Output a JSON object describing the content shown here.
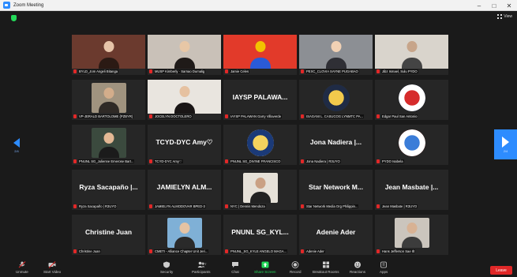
{
  "window": {
    "title": "Zoom Meeting",
    "controls": [
      "–",
      "□",
      "✕"
    ]
  },
  "view_label": "View",
  "pagination": {
    "left": "2/4",
    "right": "2/4"
  },
  "colors": {
    "accent": "#2d8cff",
    "leave": "#e02828",
    "tile_bg": "#262626",
    "muted_mic": "#e02828",
    "security": "#23d959"
  },
  "tiles": [
    {
      "name": "BYLD_Jom Angeli Bitanga",
      "big": "",
      "kind": "photo"
    },
    {
      "name": "MUSP Kimberly · Sarnao Dumalig",
      "big": "",
      "kind": "photo"
    },
    {
      "name": "Jamie Celes",
      "big": "",
      "kind": "photo"
    },
    {
      "name": "PEXC_CLOVIA SAYNE PUGABAO",
      "big": "",
      "kind": "photo"
    },
    {
      "name": "Jibz Ismael, Sulu PYDO",
      "big": "",
      "kind": "photo"
    },
    {
      "name": "VP-JERALD BARTOLOME (PZBYR)",
      "big": "",
      "kind": "photo"
    },
    {
      "name": "JOCELYN DOCTOLERO",
      "big": "",
      "kind": "photo"
    },
    {
      "name": "IAYSP PALAWAN Garry Villaverde",
      "big": "IAYSP PALAWA...",
      "kind": "text"
    },
    {
      "name": "ISAGANI L. CASUCOG LYNMTC PA...",
      "big": "",
      "kind": "logo"
    },
    {
      "name": "Edgar Paul San Antonio",
      "big": "",
      "kind": "logo"
    },
    {
      "name": "PNUNL SG_Julienne Emerose Bart...",
      "big": "",
      "kind": "photo"
    },
    {
      "name": "TCYD-DYC Amy♡",
      "big": "TCYD-DYC Amy♡",
      "kind": "text"
    },
    {
      "name": "PNUNL SG_DIVINE FRANCISCO",
      "big": "",
      "kind": "logo"
    },
    {
      "name": "Jona Nadiera | R3UYO",
      "big": "Jona Nadiera |...",
      "kind": "text"
    },
    {
      "name": "PYDO Isabela",
      "big": "",
      "kind": "logo"
    },
    {
      "name": "Ryza Sacapaño | R3UYO",
      "big": "Ryza Sacapaño |...",
      "kind": "text"
    },
    {
      "name": "JAMIELYN ALMODOVAR BPED-3",
      "big": "JAMIELYN ALM...",
      "kind": "text"
    },
    {
      "name": "NYC | Dennis Mendoza",
      "big": "",
      "kind": "photo"
    },
    {
      "name": "Star Network Media Org Philippin...",
      "big": "Star Network M...",
      "kind": "text"
    },
    {
      "name": "Jean Masbate | R3UYO",
      "big": "Jean Masbate |...",
      "kind": "text"
    },
    {
      "name": "Christine Juan",
      "big": "Christine Juan",
      "kind": "text"
    },
    {
      "name": "CMETI - Alliance Chapter Unit Jeri...",
      "big": "",
      "kind": "photo"
    },
    {
      "name": "PNUNL_SG_KYLE ANGELO MAGA...",
      "big": "PNUNL SG_KYL...",
      "kind": "text"
    },
    {
      "name": "Adenie Ader",
      "big": "Adenie Ader",
      "kind": "text"
    },
    {
      "name": "Hans Jefferson Sae Ilt",
      "big": "",
      "kind": "photo"
    }
  ],
  "toolbar": {
    "unmute": "Unmute",
    "start_video": "Start Video",
    "security": "Security",
    "participants": "Participants",
    "participants_count": "77",
    "chat": "Chat",
    "share_screen": "Share Screen",
    "record": "Record",
    "breakout": "Breakout Rooms",
    "reactions": "Reactions",
    "apps": "Apps",
    "leave": "Leave"
  }
}
